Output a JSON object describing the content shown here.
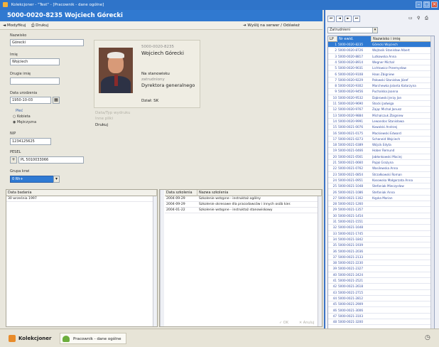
{
  "window": {
    "title": "Kolekcjoner - \"Test\" - [Pracownik - dane ogólne]"
  },
  "header": {
    "title": "5000-0020-8235   Wojciech Górecki"
  },
  "toolbar": {
    "modify": "Modyfikuj",
    "print": "Drukuj",
    "send": "Wyślij na serwer / Odśwież"
  },
  "form": {
    "surname_label": "Nazwisko",
    "surname_value": "Górecki",
    "firstname_label": "Imię",
    "firstname_value": "Wojciech",
    "secondname_label": "Drugie imię",
    "secondname_value": "",
    "birthdate_label": "Data urodzenia",
    "birthdate_value": "1950-10-03",
    "sex_label": "Płeć",
    "sex_female": "Kobieta",
    "sex_male": "Mężczyzna",
    "nip_label": "NIP",
    "nip_value": "1234125625",
    "pesel_label": "PESEL",
    "pesel_value": "PL 5010033066",
    "group_label": "Grupa krwi",
    "group_value": "0 Rh+"
  },
  "card": {
    "id": "5000-0020-8235",
    "name": "Wojciech Górecki",
    "position_label": "Na stanowisku",
    "position_sub": "zatrudniony",
    "position_value": "Dyrektora generalnego",
    "unit": "Dział: SK",
    "dim1": "Data/Typ wydruku",
    "dim2": "Inne pliki",
    "status": "Drukuj"
  },
  "grid_left": {
    "col1": "Data badania",
    "rows": [
      "30 września 1997"
    ]
  },
  "grid_mid": {
    "col1": "Data szkolenia",
    "col2": "Nazwa szkolenia",
    "rows": [
      {
        "date": "2004-09-29",
        "name": "Szkolenie wstępne - instruktaż ogólny"
      },
      {
        "date": "2004-09-29",
        "name": "Szkolenie okresowe dla pracodawców i innych osób kier."
      },
      {
        "date": "2004-01-22",
        "name": "Szkolenie wstępne - instruktaż stanowiskowy"
      }
    ],
    "ok": "OK",
    "cancel": "Anuluj"
  },
  "right": {
    "filter": "Zatrudnieni",
    "col_lp": "LP",
    "col_nr": "Nr ewid.",
    "col_name": "Nazwisko i imię",
    "rows": [
      {
        "lp": "1",
        "nr": "5000-0020-8235",
        "name": "Górecki Wojciech"
      },
      {
        "lp": "2",
        "nr": "5000-0020-8726",
        "name": "Wojtasik Stanisław Albert"
      },
      {
        "lp": "3",
        "nr": "5000-0020-8817",
        "name": "Lutkowska Anna"
      },
      {
        "lp": "4",
        "nr": "5000-0020-8914",
        "name": "Wegner Michał"
      },
      {
        "lp": "5",
        "nr": "5000-0020-9031",
        "name": "Lichtowicz Przemysław"
      },
      {
        "lp": "6",
        "nr": "5000-0020-9108",
        "name": "Haas Zbigniew"
      },
      {
        "lp": "7",
        "nr": "5000-0020-9229",
        "name": "Połowski Stanisław Józef"
      },
      {
        "lp": "8",
        "nr": "5000-0020-9302",
        "name": "Marchewka Jolanta Katarzyna"
      },
      {
        "lp": "9",
        "nr": "5000-0020-9456",
        "name": "Puchalska Joanna"
      },
      {
        "lp": "10",
        "nr": "5000-0020-9532",
        "name": "Dąbrowski Jerzy Jan"
      },
      {
        "lp": "11",
        "nr": "5000-0020-9690",
        "name": "Stocki Jadwiga"
      },
      {
        "lp": "12",
        "nr": "5000-0020-9767",
        "name": "Zając Michał Janusz"
      },
      {
        "lp": "13",
        "nr": "5000-0020-9884",
        "name": "Michalczuk Zbigniew"
      },
      {
        "lp": "14",
        "nr": "5000-0020-9991",
        "name": "Lewandos Stanisława"
      },
      {
        "lp": "15",
        "nr": "5000-0021-0076",
        "name": "Kowalski Andrzej"
      },
      {
        "lp": "16",
        "nr": "5000-0021-0175",
        "name": "Mackiewski Edward"
      },
      {
        "lp": "17",
        "nr": "5000-0021-0273",
        "name": "Schaneid Wojciech"
      },
      {
        "lp": "18",
        "nr": "5000-0021-0389",
        "name": "Wójcik Edyta"
      },
      {
        "lp": "19",
        "nr": "5000-0021-0466",
        "name": "Hober Remund"
      },
      {
        "lp": "20",
        "nr": "5000-0021-0561",
        "name": "Jabłonkowski Maciej"
      },
      {
        "lp": "21",
        "nr": "5000-0021-0660",
        "name": "Pająk Grażyna"
      },
      {
        "lp": "22",
        "nr": "5000-0021-0762",
        "name": "Wasilewska Anna"
      },
      {
        "lp": "23",
        "nr": "5000-0021-0854",
        "name": "Strzałkowski Roman"
      },
      {
        "lp": "24",
        "nr": "5000-0021-0951",
        "name": "Kosowska Małgorzata Anna"
      },
      {
        "lp": "25",
        "nr": "5000-0021-1048",
        "name": "Stefaniak Mieczysław"
      },
      {
        "lp": "26",
        "nr": "5000-0021-1086",
        "name": "Stefaniak Anna"
      },
      {
        "lp": "27",
        "nr": "5000-0021-1162",
        "name": "Kępka Marian"
      },
      {
        "lp": "28",
        "nr": "5000-0021-1260",
        "name": ""
      },
      {
        "lp": "29",
        "nr": "5000-0021-1357",
        "name": ""
      },
      {
        "lp": "30",
        "nr": "5000-0021-1454",
        "name": ""
      },
      {
        "lp": "31",
        "nr": "5000-0021-1551",
        "name": ""
      },
      {
        "lp": "32",
        "nr": "5000-0021-1648",
        "name": ""
      },
      {
        "lp": "33",
        "nr": "5000-0021-1745",
        "name": ""
      },
      {
        "lp": "34",
        "nr": "5000-0021-1842",
        "name": ""
      },
      {
        "lp": "35",
        "nr": "5000-0021-1939",
        "name": ""
      },
      {
        "lp": "36",
        "nr": "5000-0021-2036",
        "name": ""
      },
      {
        "lp": "37",
        "nr": "5000-0021-2133",
        "name": ""
      },
      {
        "lp": "38",
        "nr": "5000-0021-2230",
        "name": ""
      },
      {
        "lp": "39",
        "nr": "5000-0021-2327",
        "name": ""
      },
      {
        "lp": "40",
        "nr": "5000-0021-2424",
        "name": ""
      },
      {
        "lp": "41",
        "nr": "5000-0021-2521",
        "name": ""
      },
      {
        "lp": "42",
        "nr": "5000-0021-2618",
        "name": ""
      },
      {
        "lp": "43",
        "nr": "5000-0021-2715",
        "name": ""
      },
      {
        "lp": "44",
        "nr": "5000-0021-2812",
        "name": ""
      },
      {
        "lp": "45",
        "nr": "5000-0021-2909",
        "name": ""
      },
      {
        "lp": "46",
        "nr": "5000-0021-3006",
        "name": ""
      },
      {
        "lp": "47",
        "nr": "5000-0021-3103",
        "name": ""
      },
      {
        "lp": "48",
        "nr": "5000-0021-3200",
        "name": ""
      }
    ]
  },
  "statusbar": {
    "tab1": "Kolekcjoner",
    "tab2": "Pracownik - dane ogólne"
  },
  "colors": {
    "title_blue": "#2f74c9",
    "selection_blue": "#2f7ad3",
    "panel_bg": "#e9e7dd"
  }
}
